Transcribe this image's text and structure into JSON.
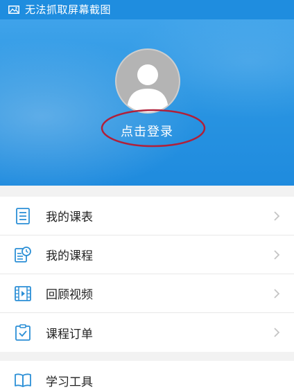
{
  "status_bar": {
    "text": "无法抓取屏幕截图",
    "icon": "image-icon"
  },
  "profile": {
    "avatar": "default-avatar-icon",
    "login_label": "点击登录",
    "highlight_color": "#b0203a"
  },
  "menu": {
    "items": [
      {
        "label": "我的课表",
        "icon": "schedule-icon"
      },
      {
        "label": "我的课程",
        "icon": "course-clock-icon"
      },
      {
        "label": "回顾视频",
        "icon": "film-icon"
      },
      {
        "label": "课程订单",
        "icon": "order-clipboard-icon"
      }
    ]
  },
  "tools": {
    "items": [
      {
        "label": "学习工具",
        "icon": "book-icon"
      }
    ]
  },
  "colors": {
    "accent": "#1f8ddf",
    "icon": "#2b8fd6",
    "chevron": "#c4c4c4"
  }
}
